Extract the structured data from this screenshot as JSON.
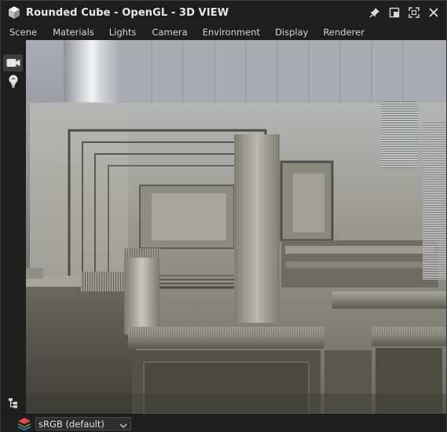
{
  "window": {
    "title": "Rounded Cube - OpenGL - 3D VIEW"
  },
  "title_actions": [
    {
      "name": "pin-icon"
    },
    {
      "name": "dock-icon"
    },
    {
      "name": "maximize-icon"
    },
    {
      "name": "close-icon"
    }
  ],
  "menu": {
    "items": [
      "Scene",
      "Materials",
      "Lights",
      "Camera",
      "Environment",
      "Display",
      "Renderer"
    ]
  },
  "toolbar": {
    "tools": [
      {
        "name": "camera-icon",
        "active": true
      },
      {
        "name": "lightbulb-icon",
        "active": false
      }
    ],
    "bottom_tool": {
      "name": "hierarchy-icon"
    }
  },
  "bottombar": {
    "layers_icon": "layers-icon",
    "colorspace": {
      "value": "sRGB (default)"
    }
  },
  "colors": {
    "chrome": "#1e1e1e",
    "text": "#e8e8e8",
    "active_tool": "#3c3c3c"
  }
}
